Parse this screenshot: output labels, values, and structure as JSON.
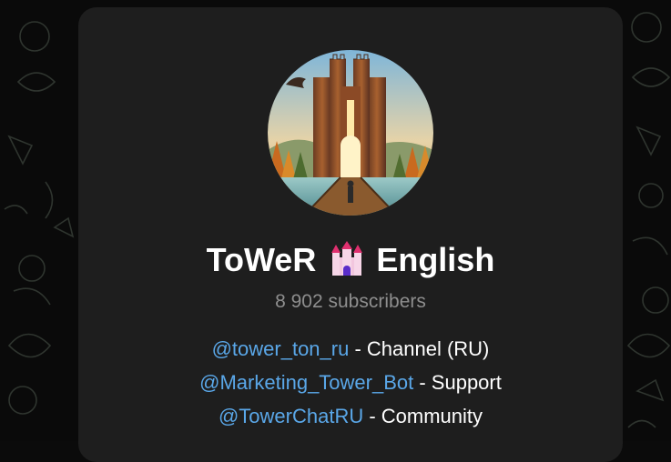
{
  "channel": {
    "title_part1": "ToWeR",
    "title_emoji": "castle-emoji",
    "title_part2": "English",
    "subscribers": "8 902 subscribers"
  },
  "description": {
    "lines": [
      {
        "handle": "@tower_ton_ru",
        "text": " - Channel (RU)"
      },
      {
        "handle": "@Marketing_Tower_Bot",
        "text": " - Support"
      },
      {
        "handle": "@TowerChatRU",
        "text": " - Community"
      }
    ]
  },
  "colors": {
    "background": "#0a0a0a",
    "card": "#1e1e1e",
    "link": "#5aa7e8",
    "muted": "#8e8e8e",
    "text": "#ffffff"
  }
}
